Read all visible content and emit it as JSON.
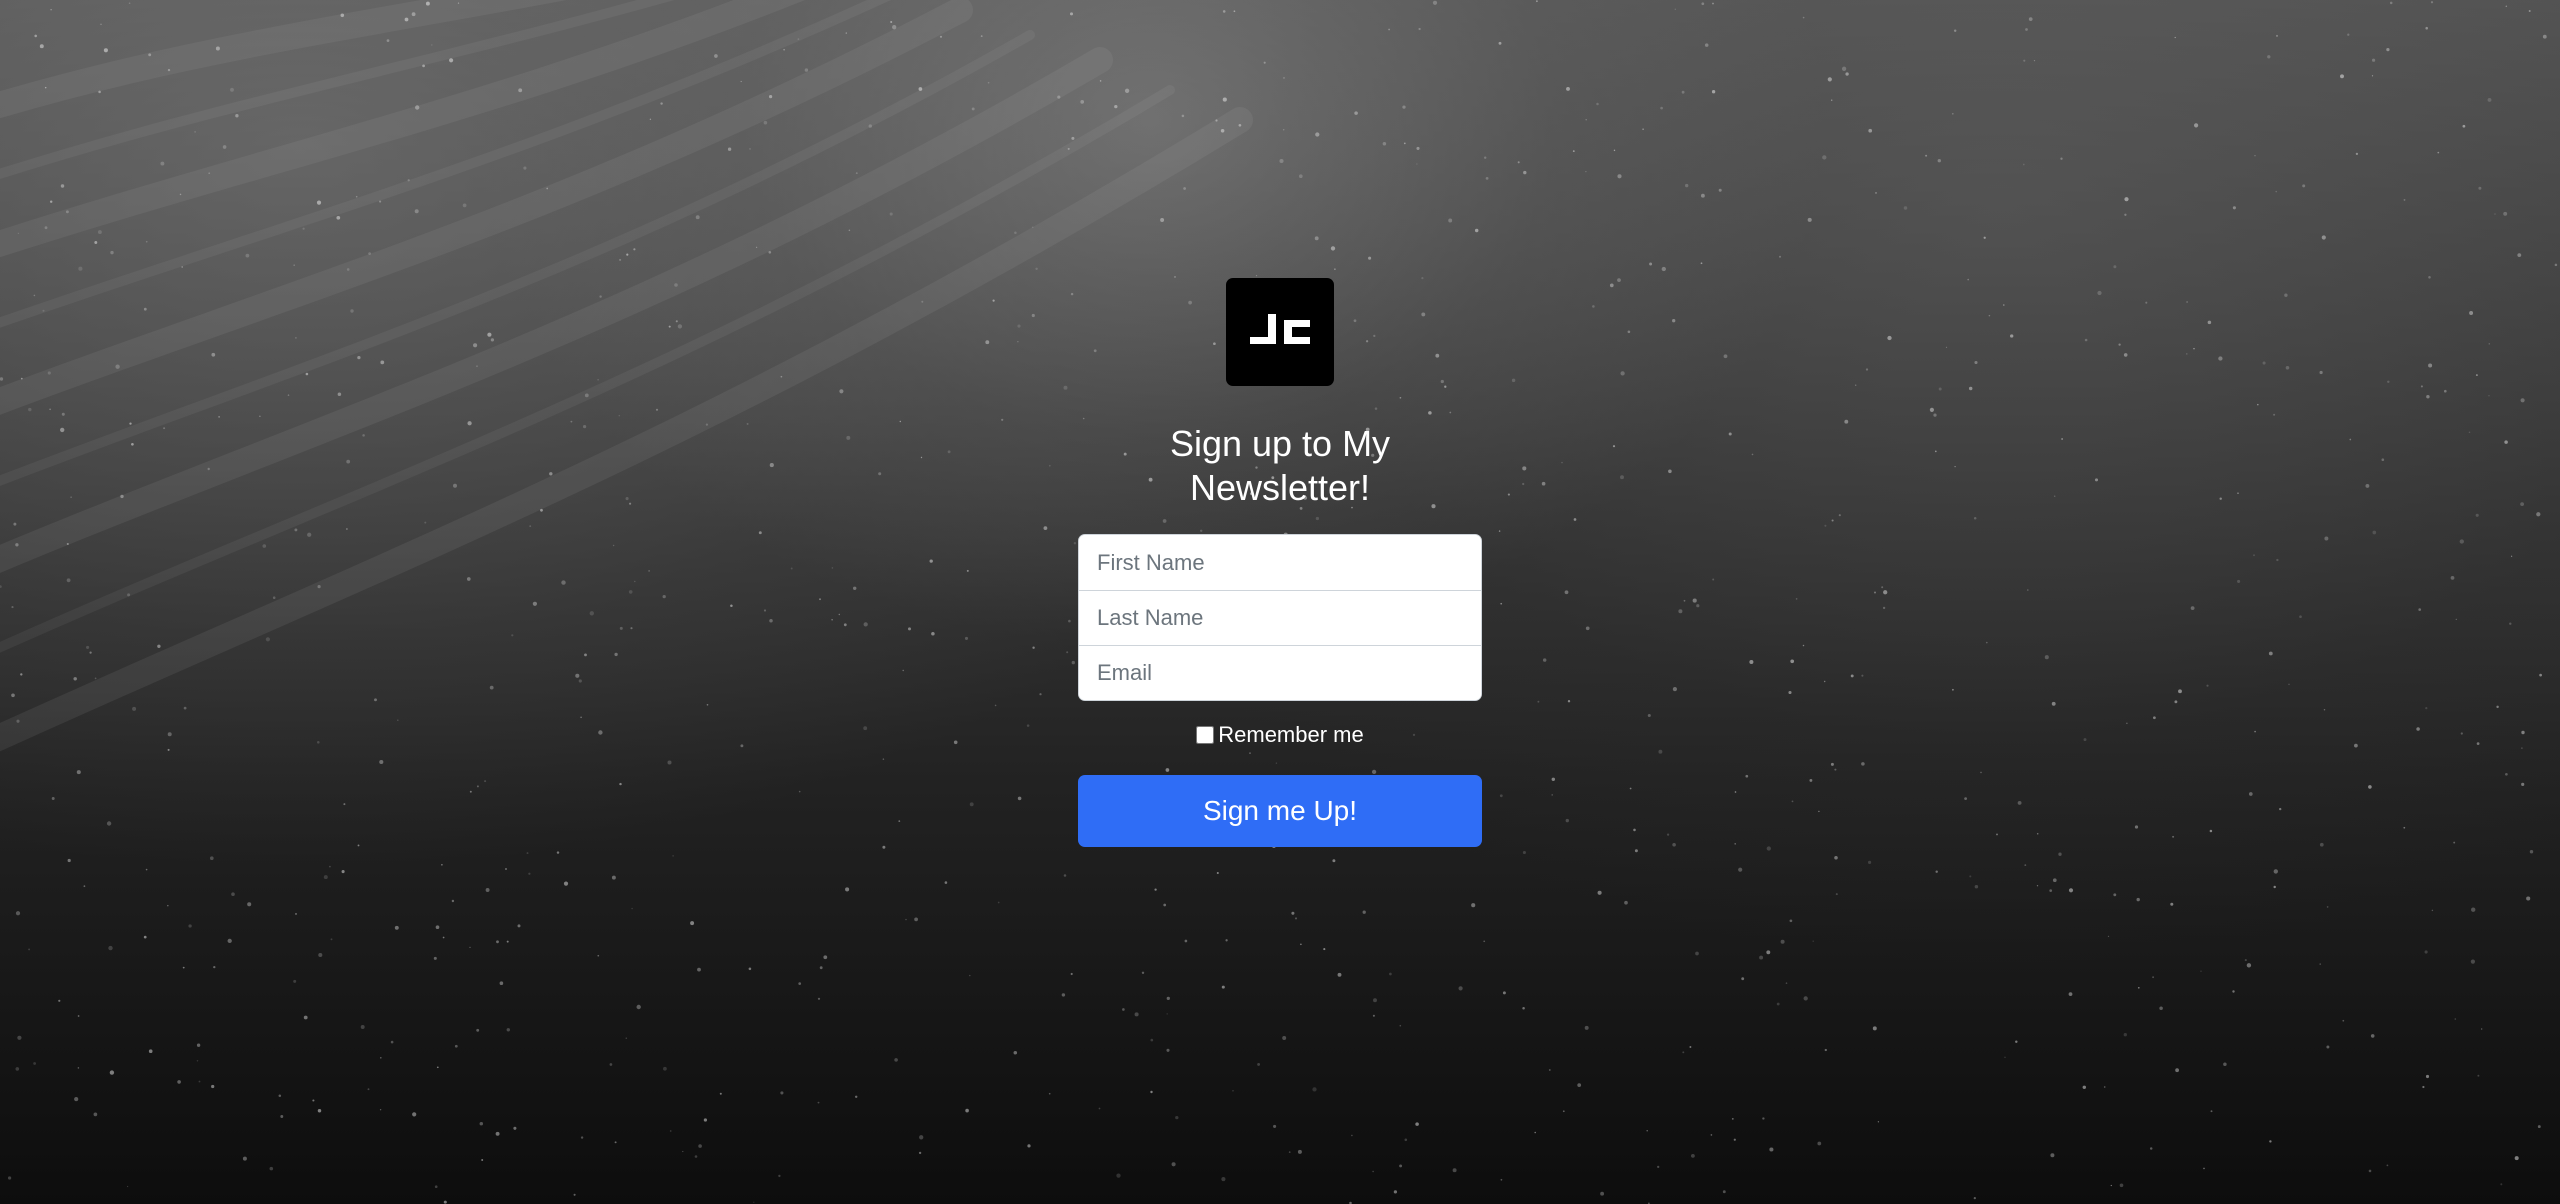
{
  "form": {
    "heading": "Sign up to My Newsletter!",
    "first_name_placeholder": "First Name",
    "first_name_value": "",
    "last_name_placeholder": "Last Name",
    "last_name_value": "",
    "email_placeholder": "Email",
    "email_value": "",
    "remember_label": "Remember me",
    "remember_checked": false,
    "submit_label": "Sign me Up!"
  },
  "logo": {
    "icon": "jc-logo-icon",
    "background_color": "#000000"
  },
  "colors": {
    "accent": "#2f6df6",
    "heading_text": "#ffffff",
    "background": "#2a2a2a"
  }
}
